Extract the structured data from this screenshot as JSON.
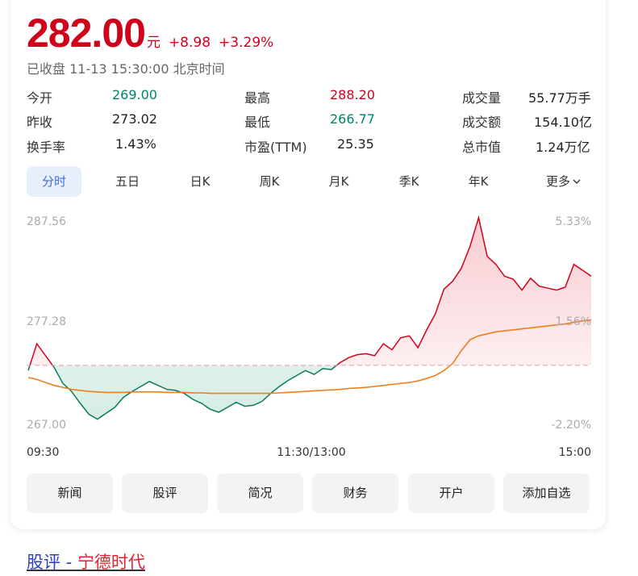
{
  "quote": {
    "price": "282.00",
    "unit": "元",
    "change": "+8.98",
    "change_pct": "+3.29%",
    "status": "已收盘 11-13 15:30:00 北京时间"
  },
  "stats": {
    "open": {
      "label": "今开",
      "value": "269.00"
    },
    "prev_close": {
      "label": "昨收",
      "value": "273.02"
    },
    "turnover_rate": {
      "label": "换手率",
      "value": "1.43%"
    },
    "high": {
      "label": "最高",
      "value": "288.20"
    },
    "low": {
      "label": "最低",
      "value": "266.77"
    },
    "pe": {
      "label": "市盈(TTM)",
      "value": "25.35"
    },
    "volume": {
      "label": "成交量",
      "value": "55.77万手"
    },
    "amount": {
      "label": "成交额",
      "value": "154.10亿"
    },
    "market_cap": {
      "label": "总市值",
      "value": "1.24万亿"
    }
  },
  "tabs": [
    "分时",
    "五日",
    "日K",
    "周K",
    "月K",
    "季K",
    "年K",
    "更多"
  ],
  "active_tab": "分时",
  "chart_data": {
    "type": "line",
    "y_left_ticks": [
      "287.56",
      "277.28",
      "267.00"
    ],
    "y_right_ticks": [
      "5.33%",
      "1.56%",
      "-2.20%"
    ],
    "x_ticks": [
      "09:30",
      "11:30/13:00",
      "15:00"
    ],
    "reference_price": 273.02,
    "ylim": [
      267.0,
      287.56
    ],
    "colors": {
      "up": "#d0021b",
      "down": "#0a7a5e",
      "avg": "#f07e1e",
      "ref": "#f39ba0"
    },
    "series": [
      {
        "values": [
          272.5,
          275.2,
          274.0,
          272.8,
          271.2,
          270.4,
          269.2,
          268.1,
          267.6,
          268.2,
          268.8,
          269.8,
          270.4,
          270.9,
          271.4,
          271.0,
          270.6,
          270.5,
          270.2,
          269.6,
          269.2,
          268.6,
          268.3,
          268.8,
          269.3,
          268.9,
          269.0,
          269.4,
          270.2,
          270.9,
          271.5,
          272.0,
          272.5,
          272.1,
          272.7,
          272.6,
          273.3,
          273.8,
          274.1,
          274.2,
          274.0,
          275.2,
          274.6,
          275.8,
          276.0,
          274.8,
          276.6,
          278.2,
          280.7,
          281.5,
          282.8,
          285.0,
          287.9,
          284.0,
          283.2,
          282.0,
          281.7,
          280.6,
          281.8,
          281.0,
          280.8,
          280.6,
          280.9,
          283.2,
          282.6,
          282.0
        ],
        "avg": [
          271.8,
          271.6,
          271.3,
          271.0,
          270.8,
          270.6,
          270.5,
          270.4,
          270.35,
          270.3,
          270.3,
          270.3,
          270.35,
          270.35,
          270.35,
          270.35,
          270.3,
          270.3,
          270.3,
          270.25,
          270.25,
          270.2,
          270.2,
          270.2,
          270.2,
          270.2,
          270.2,
          270.2,
          270.2,
          270.25,
          270.3,
          270.35,
          270.4,
          270.45,
          270.5,
          270.55,
          270.6,
          270.7,
          270.75,
          270.8,
          270.9,
          271.0,
          271.1,
          271.2,
          271.3,
          271.45,
          271.7,
          272.0,
          272.5,
          273.2,
          274.5,
          275.6,
          276.0,
          276.2,
          276.4,
          276.5,
          276.6,
          276.7,
          276.8,
          276.9,
          277.0,
          277.1,
          277.2,
          277.35,
          277.5,
          277.6
        ]
      }
    ]
  },
  "actions": [
    "新闻",
    "股评",
    "简况",
    "财务",
    "开户",
    "添加自选"
  ],
  "footer_link": {
    "part1": "股评 - ",
    "part2": "宁德时代"
  }
}
